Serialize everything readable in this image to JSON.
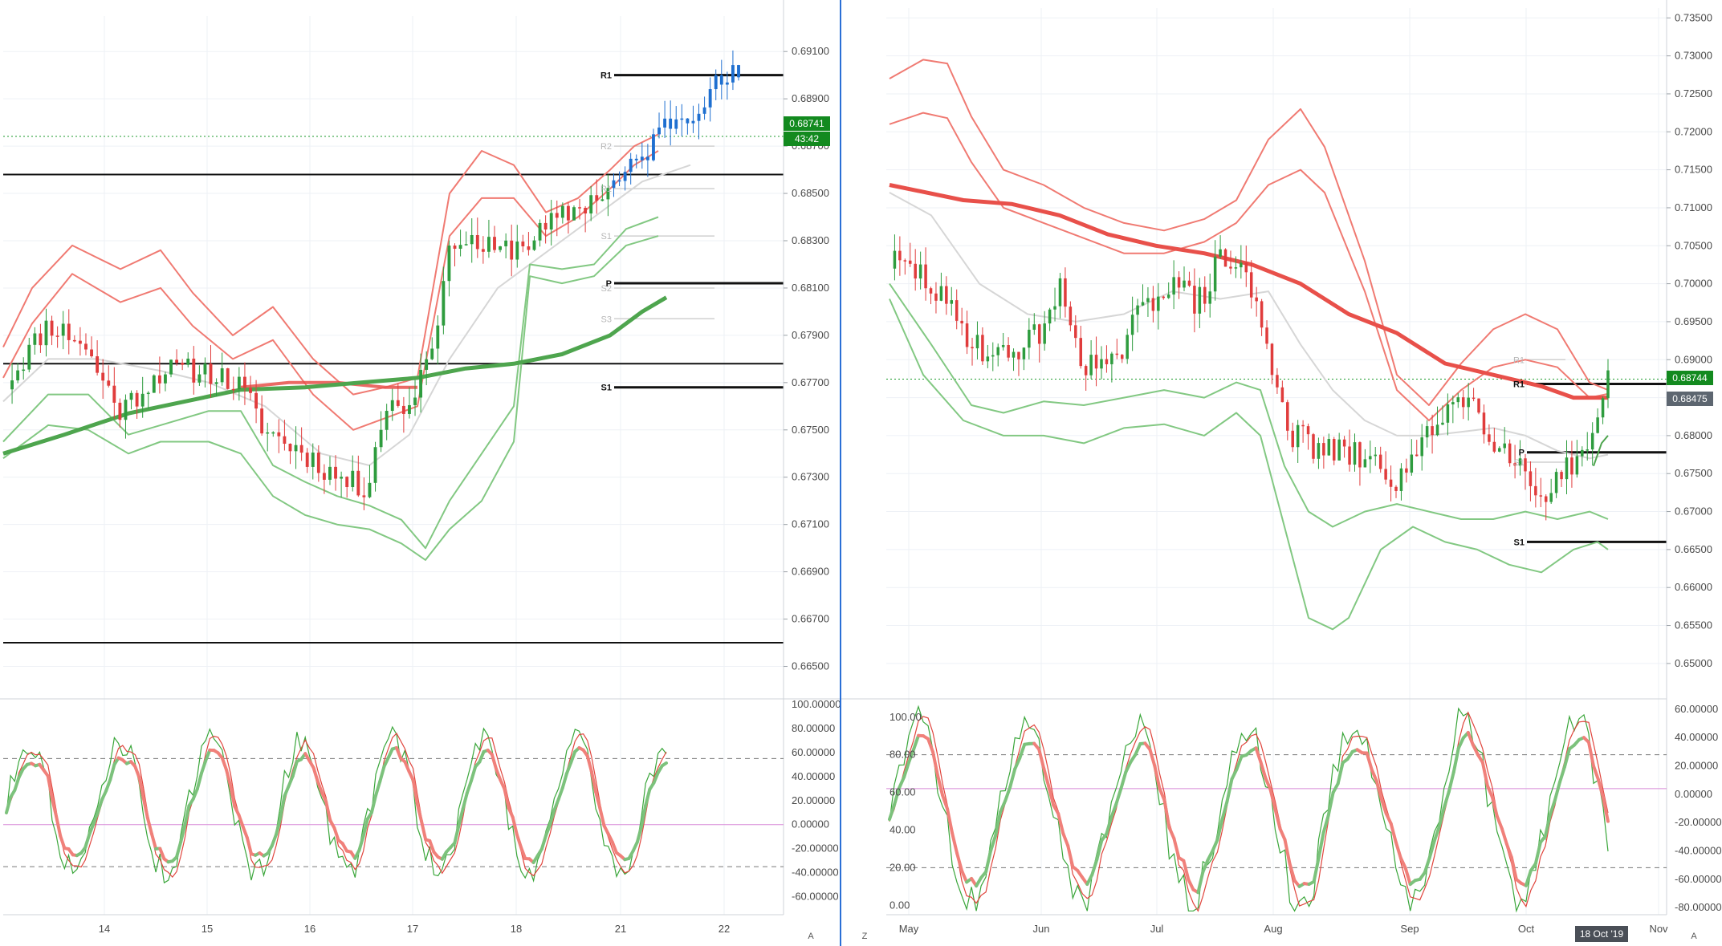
{
  "colors": {
    "bull": "#2e9c3e",
    "bear": "#e03c3c",
    "blue": "#1e6fd0",
    "bb_red": "#f07a72",
    "bb_green": "#82c882",
    "ma_red": "#e8504a",
    "ma_green": "#4ea54e",
    "mid_grey": "#d6d6d6",
    "tag_green": "#138a1f",
    "tag_grey": "#5d6670",
    "stoch_green": "#3aa63a",
    "stoch_red": "#e0453d",
    "stoch_thick_green": "#7cc27c",
    "stoch_thick_red": "#f0807a"
  },
  "chart_data": [
    {
      "panel": "left-intraday",
      "type": "candlestick",
      "x_ticks": [
        "14",
        "15",
        "16",
        "17",
        "18",
        "21",
        "22"
      ],
      "y_ticks": [
        "0.69100",
        "0.68900",
        "0.68700",
        "0.68500",
        "0.68300",
        "0.68100",
        "0.67900",
        "0.67700",
        "0.67500",
        "0.67300",
        "0.67100",
        "0.66900",
        "0.66700",
        "0.66500"
      ],
      "ylim": [
        0.664,
        0.6925
      ],
      "price_tag": "0.68741",
      "timer_tag": "43:42",
      "last_price": 0.68741,
      "pivots": [
        {
          "label": "R1",
          "value": 0.69
        },
        {
          "label": "P",
          "value": 0.6812
        },
        {
          "label": "S1",
          "value": 0.6768
        }
      ],
      "faint_pivots": [
        {
          "label": "R2",
          "value": 0.687
        },
        {
          "label": "R1",
          "value": 0.6852
        },
        {
          "label": "S1",
          "value": 0.6832
        },
        {
          "label": "S2",
          "value": 0.681
        },
        {
          "label": "S3",
          "value": 0.6797
        }
      ],
      "levels": [
        0.6858,
        0.6778,
        0.666
      ],
      "oscillator": {
        "y_ticks": [
          "100.00000",
          "80.00000",
          "60.00000",
          "40.00000",
          "20.00000",
          "0.00000",
          "-20.00000",
          "-40.00000",
          "-60.00000"
        ],
        "ylim": [
          -75,
          102
        ],
        "dashed_levels": [
          55,
          -35
        ],
        "zero_level": 0
      },
      "bottom_corner": "A"
    },
    {
      "panel": "right-daily",
      "type": "candlestick",
      "x_ticks": [
        "May",
        "Jun",
        "Jul",
        "Aug",
        "Sep",
        "Oct",
        "Nov"
      ],
      "y_ticks": [
        "0.73500",
        "0.73000",
        "0.72500",
        "0.72000",
        "0.71500",
        "0.71000",
        "0.70500",
        "0.70000",
        "0.69500",
        "0.69000",
        "0.68500",
        "0.68000",
        "0.67500",
        "0.67000",
        "0.66500",
        "0.66000",
        "0.65500",
        "0.65000"
      ],
      "ylim": [
        0.6465,
        0.7363
      ],
      "price_tag": "0.68744",
      "price_tag_2": "0.68475",
      "date_tag": "18 Oct '19",
      "last_price": 0.68744,
      "pivots": [
        {
          "label": "R1",
          "value": 0.6868
        },
        {
          "label": "P",
          "value": 0.6778
        },
        {
          "label": "S1",
          "value": 0.666
        }
      ],
      "faint_pivots": [
        {
          "label": "R1",
          "value": 0.69
        },
        {
          "label": "S1",
          "value": 0.6765
        }
      ],
      "oscillator": {
        "y_ticks_left": [
          "100.00",
          "80.00",
          "60.00",
          "40.00",
          "20.00",
          "0.00"
        ],
        "y_ticks_right": [
          "60.00000",
          "40.00000",
          "20.00000",
          "0.00000",
          "-20.00000",
          "-40.00000",
          "-60.00000",
          "-80.00000"
        ],
        "ylim": [
          -5,
          108
        ],
        "dashed_levels": [
          80,
          20
        ],
        "pink_level": 62
      },
      "bottom_corner_left": "Z",
      "bottom_corner": "A"
    }
  ]
}
